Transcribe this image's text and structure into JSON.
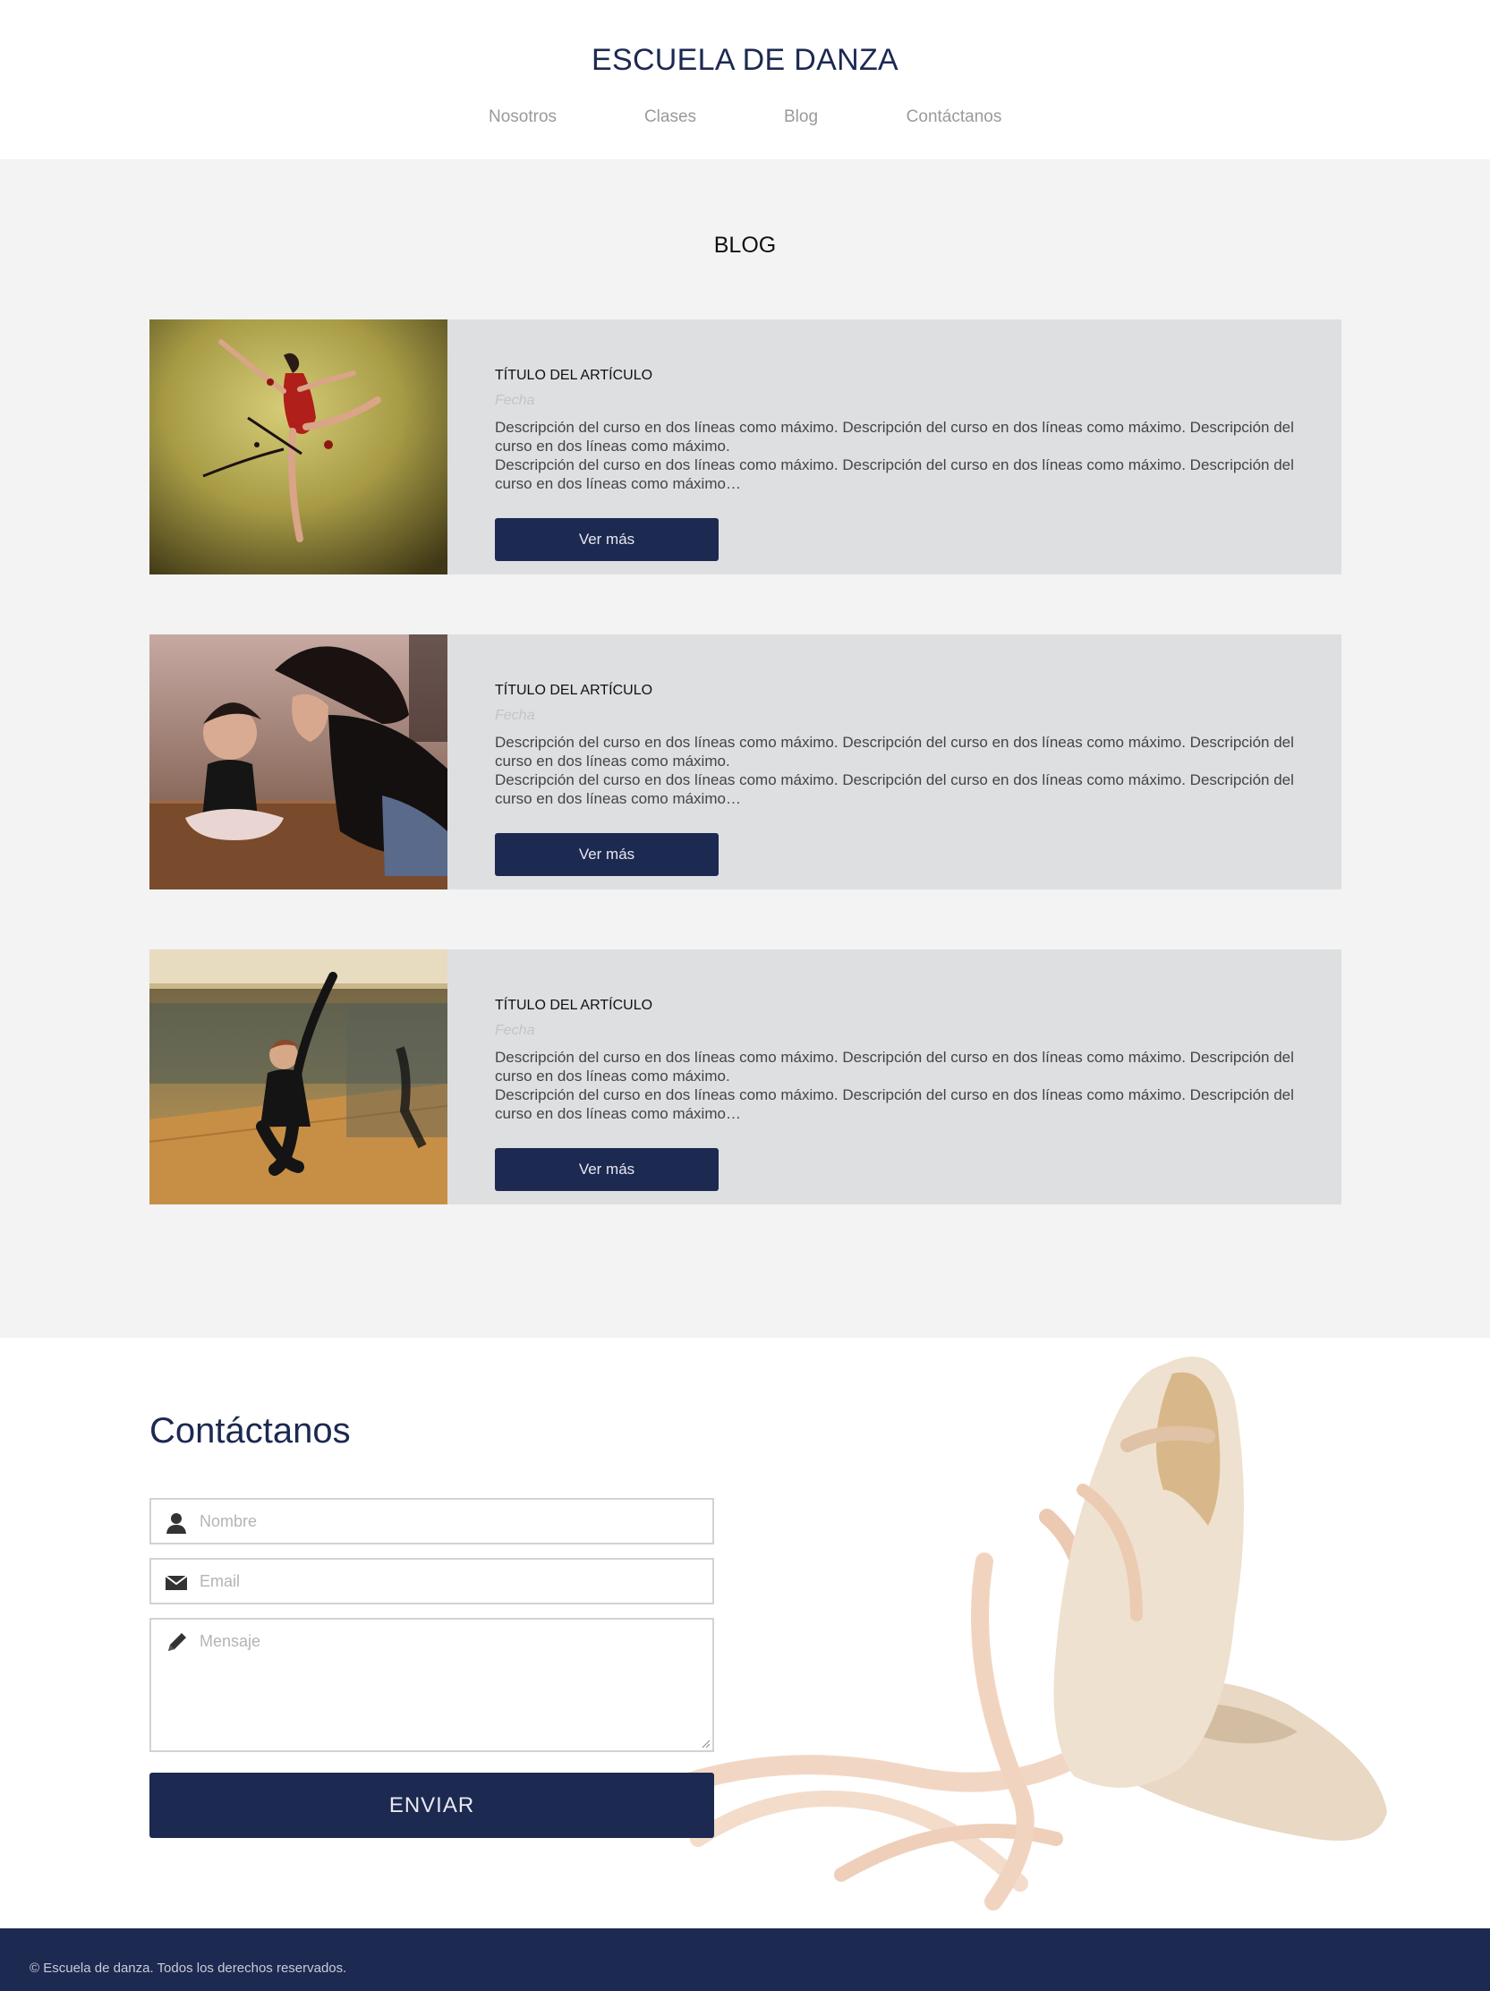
{
  "header": {
    "site_title": "ESCUELA DE DANZA",
    "nav": [
      {
        "label": "Nosotros"
      },
      {
        "label": "Clases"
      },
      {
        "label": "Blog"
      },
      {
        "label": "Contáctanos"
      }
    ]
  },
  "blog": {
    "heading": "BLOG",
    "articles": [
      {
        "title": "TÍTULO DEL ARTÍCULO",
        "date": "Fecha",
        "desc_line1": "Descripción del curso en dos líneas como máximo. Descripción del curso en dos líneas como máximo. Descripción del curso en dos líneas como máximo.",
        "desc_line2": "Descripción del curso en dos líneas como máximo. Descripción del curso en dos líneas como máximo. Descripción del curso en dos líneas como máximo…",
        "button": "Ver más",
        "image_icon": "dancer-photo"
      },
      {
        "title": "TÍTULO DEL ARTÍCULO",
        "date": "Fecha",
        "desc_line1": "Descripción del curso en dos líneas como máximo. Descripción del curso en dos líneas como máximo. Descripción del curso en dos líneas como máximo.",
        "desc_line2": "Descripción del curso en dos líneas como máximo. Descripción del curso en dos líneas como máximo. Descripción del curso en dos líneas como máximo…",
        "button": "Ver más",
        "image_icon": "teacher-child-photo"
      },
      {
        "title": "TÍTULO DEL ARTÍCULO",
        "date": "Fecha",
        "desc_line1": "Descripción del curso en dos líneas como máximo. Descripción del curso en dos líneas como máximo. Descripción del curso en dos líneas como máximo.",
        "desc_line2": "Descripción del curso en dos líneas como máximo. Descripción del curso en dos líneas como máximo. Descripción del curso en dos líneas como máximo…",
        "button": "Ver más",
        "image_icon": "studio-barre-photo"
      }
    ]
  },
  "contact": {
    "heading": "Contáctanos",
    "name_placeholder": "Nombre",
    "email_placeholder": "Email",
    "message_placeholder": "Mensaje",
    "submit": "ENVIAR",
    "image_icon": "ballet-shoes-photo"
  },
  "footer": {
    "text": "© Escuela de danza. Todos los derechos reservados."
  },
  "colors": {
    "brand_navy": "#1c2951",
    "section_gray": "#f3f3f3",
    "card_gray": "#dedfe1"
  }
}
